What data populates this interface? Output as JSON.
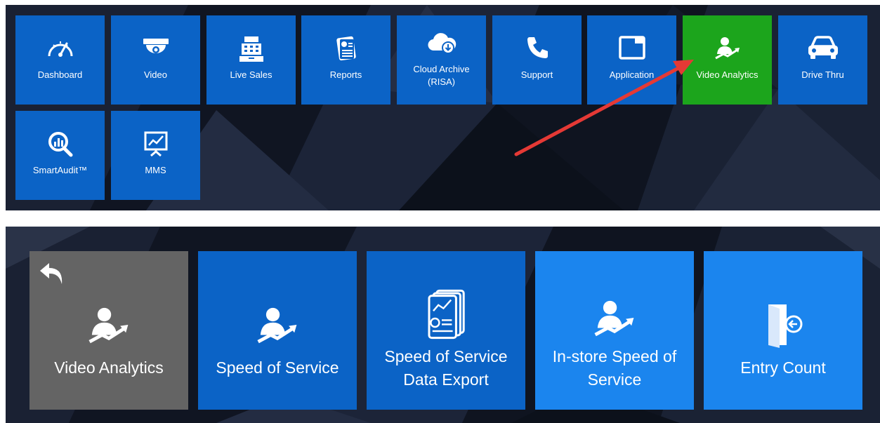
{
  "top_menu": {
    "tiles": [
      {
        "label": "Dashboard",
        "icon": "speedometer-icon"
      },
      {
        "label": "Video",
        "icon": "security-camera-icon"
      },
      {
        "label": "Live Sales",
        "icon": "cash-register-icon"
      },
      {
        "label": "Reports",
        "icon": "report-document-icon"
      },
      {
        "label": "Cloud Archive (RISA)",
        "icon": "cloud-download-icon"
      },
      {
        "label": "Support",
        "icon": "phone-icon"
      },
      {
        "label": "Application",
        "icon": "window-icon"
      },
      {
        "label": "Video Analytics",
        "icon": "person-trend-icon",
        "highlighted": true
      },
      {
        "label": "Drive Thru",
        "icon": "car-icon"
      },
      {
        "label": "SmartAudit™",
        "icon": "magnifier-chart-icon"
      },
      {
        "label": "MMS",
        "icon": "presentation-board-icon"
      }
    ]
  },
  "sub_menu": {
    "tiles": [
      {
        "label": "Video Analytics",
        "icon": "person-trend-icon",
        "back_icon": "back-arrow-icon"
      },
      {
        "label": "Speed of Service",
        "icon": "person-trend-icon"
      },
      {
        "label": "Speed of Service Data Export",
        "icon": "report-stack-icon"
      },
      {
        "label": "In-store Speed of Service",
        "icon": "person-trend-icon"
      },
      {
        "label": "Entry Count",
        "icon": "door-entry-icon"
      }
    ]
  },
  "colors": {
    "tile_blue": "#0b63c6",
    "tile_light_blue": "#1b85ee",
    "tile_gray": "#646464",
    "highlight_green": "#1ca51c",
    "annotation_red": "#e53935",
    "background": "#141a28"
  }
}
